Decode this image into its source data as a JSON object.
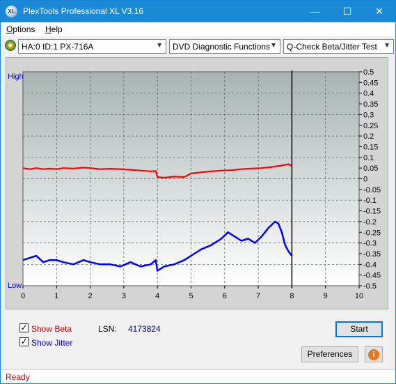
{
  "window": {
    "title": "PlexTools Professional XL V3.16",
    "icon_text": "XL",
    "controls": {
      "minimize": "—",
      "maximize": "☐",
      "close": "✕"
    }
  },
  "menu": [
    {
      "label": "Options",
      "accel": "O",
      "rest": "ptions"
    },
    {
      "label": "Help",
      "accel": "H",
      "rest": "elp"
    }
  ],
  "toolbar": {
    "drive": "HA:0 ID:1  PX-716A",
    "function": "DVD Diagnostic Functions",
    "test": "Q-Check Beta/Jitter Test",
    "arrow": "▼"
  },
  "chart_data": {
    "type": "line",
    "left_axis_labels": {
      "top": "High",
      "bottom": "Low"
    },
    "x_ticks": [
      "0",
      "1",
      "2",
      "3",
      "4",
      "5",
      "6",
      "7",
      "8",
      "9",
      "10"
    ],
    "xlim": [
      0,
      10
    ],
    "y_ticks": [
      "0.5",
      "0.45",
      "0.4",
      "0.35",
      "0.3",
      "0.25",
      "0.2",
      "0.15",
      "0.1",
      "0.05",
      "0",
      "-0.05",
      "-0.1",
      "-0.15",
      "-0.2",
      "-0.25",
      "-0.3",
      "-0.35",
      "-0.4",
      "-0.45",
      "-0.5"
    ],
    "ylim": [
      -0.5,
      0.5
    ],
    "grid": true,
    "cursor_x": 8.0,
    "colors": {
      "beta": "#ff0000",
      "jitter": "#0000ff",
      "plot_top": "#a8b4b4",
      "plot_bottom": "#ffffff"
    },
    "series": [
      {
        "name": "Beta",
        "x": [
          0,
          0.2,
          0.4,
          0.6,
          0.8,
          1.0,
          1.2,
          1.5,
          1.8,
          2.0,
          2.3,
          2.6,
          2.9,
          3.2,
          3.5,
          3.8,
          3.95,
          4.0,
          4.2,
          4.5,
          4.8,
          5.0,
          5.3,
          5.6,
          5.9,
          6.2,
          6.5,
          6.8,
          7.1,
          7.4,
          7.7,
          7.9,
          8.0
        ],
        "y": [
          0.05,
          0.045,
          0.05,
          0.045,
          0.048,
          0.045,
          0.05,
          0.048,
          0.052,
          0.05,
          0.045,
          0.047,
          0.045,
          0.042,
          0.038,
          0.035,
          0.036,
          0.008,
          0.005,
          0.01,
          0.008,
          0.025,
          0.03,
          0.035,
          0.038,
          0.04,
          0.045,
          0.048,
          0.05,
          0.055,
          0.062,
          0.068,
          0.06
        ]
      },
      {
        "name": "Jitter",
        "x": [
          0,
          0.2,
          0.4,
          0.6,
          0.8,
          1.0,
          1.2,
          1.5,
          1.8,
          2.0,
          2.3,
          2.6,
          2.9,
          3.2,
          3.5,
          3.8,
          3.95,
          4.0,
          4.2,
          4.5,
          4.8,
          5.0,
          5.3,
          5.6,
          5.9,
          6.1,
          6.3,
          6.5,
          6.7,
          6.9,
          7.1,
          7.3,
          7.5,
          7.6,
          7.7,
          7.8,
          7.9,
          8.0
        ],
        "y": [
          -0.38,
          -0.37,
          -0.36,
          -0.39,
          -0.38,
          -0.38,
          -0.39,
          -0.4,
          -0.38,
          -0.39,
          -0.4,
          -0.4,
          -0.41,
          -0.39,
          -0.41,
          -0.4,
          -0.38,
          -0.43,
          -0.41,
          -0.4,
          -0.38,
          -0.36,
          -0.33,
          -0.31,
          -0.28,
          -0.25,
          -0.27,
          -0.29,
          -0.28,
          -0.3,
          -0.27,
          -0.23,
          -0.2,
          -0.21,
          -0.25,
          -0.31,
          -0.34,
          -0.36
        ]
      }
    ]
  },
  "controls": {
    "show_beta": {
      "label": "Show Beta",
      "checked": true,
      "color": "#cc0000"
    },
    "show_jitter": {
      "label": "Show Jitter",
      "checked": true,
      "color": "#0000cc"
    },
    "lsn_label": "LSN:",
    "lsn_value": "4173824",
    "start": "Start",
    "preferences": "Preferences",
    "info_icon": "i"
  },
  "status": {
    "text": "Ready"
  }
}
